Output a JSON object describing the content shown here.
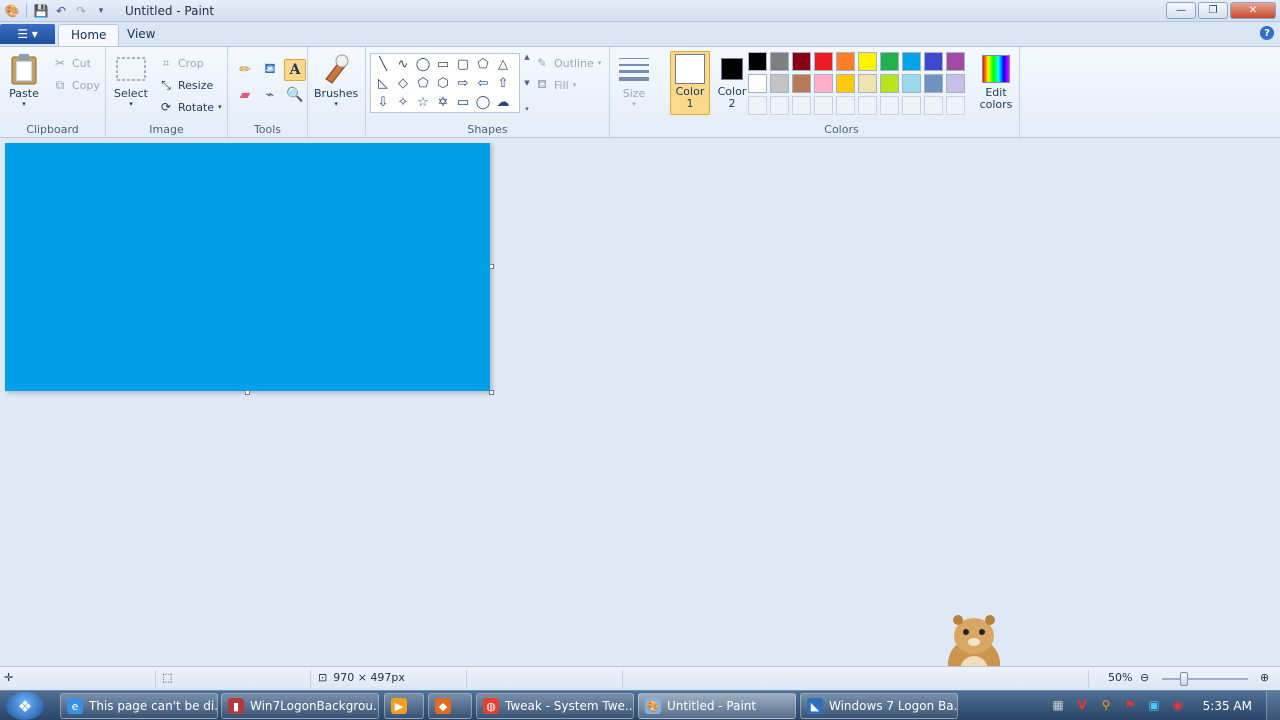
{
  "window": {
    "title": "Untitled - Paint",
    "minimize": "—",
    "restore": "❐",
    "close": "✕"
  },
  "tabs": {
    "home": "Home",
    "view": "View",
    "help": "?"
  },
  "clipboard": {
    "label": "Clipboard",
    "paste": "Paste",
    "cut": "Cut",
    "copy": "Copy"
  },
  "image": {
    "label": "Image",
    "select": "Select",
    "crop": "Crop",
    "resize": "Resize",
    "rotate": "Rotate"
  },
  "tools": {
    "label": "Tools"
  },
  "brushes": {
    "label": "Brushes"
  },
  "shapes": {
    "label": "Shapes",
    "outline": "Outline",
    "fill": "Fill"
  },
  "size": {
    "label": "Size"
  },
  "colors": {
    "label": "Colors",
    "color1_label": "Color\n1",
    "color2_label": "Color\n2",
    "color1": "#ffffff",
    "color2": "#000000",
    "edit": "Edit colors",
    "palette_row1": [
      "#000000",
      "#7f7f7f",
      "#880015",
      "#ed1c24",
      "#ff7f27",
      "#fff200",
      "#22b14c",
      "#00a2e8",
      "#3f48cc",
      "#a349a4"
    ],
    "palette_row2": [
      "#ffffff",
      "#c3c3c3",
      "#b97a57",
      "#ffaec9",
      "#ffc90e",
      "#efe4b0",
      "#b5e61d",
      "#99d9ea",
      "#7092be",
      "#c8bfe7"
    ]
  },
  "canvas": {
    "background": "#009fe8"
  },
  "status": {
    "dimensions": "970 × 497px",
    "zoom": "50%",
    "zoom_level": 0.5
  },
  "taskbar": {
    "items": [
      {
        "label": "This page can't be di...",
        "icon": "ie-icon",
        "color": "#3b8fe0"
      },
      {
        "label": "Win7LogonBackgrou...",
        "icon": "app-icon",
        "color": "#b33a3a"
      },
      {
        "label": "",
        "icon": "media-player-icon",
        "color": "#f0a020"
      },
      {
        "label": "",
        "icon": "gadget-icon",
        "color": "#e06a20"
      },
      {
        "label": "Tweak - System Twe...",
        "icon": "chrome-icon",
        "color": "#e34133"
      },
      {
        "label": "Untitled - Paint",
        "icon": "paint-icon",
        "color": "#7fb3e8"
      },
      {
        "label": "Windows 7 Logon Ba...",
        "icon": "vs-icon",
        "color": "#2d6fb8"
      }
    ],
    "clock": "5:35 AM"
  }
}
